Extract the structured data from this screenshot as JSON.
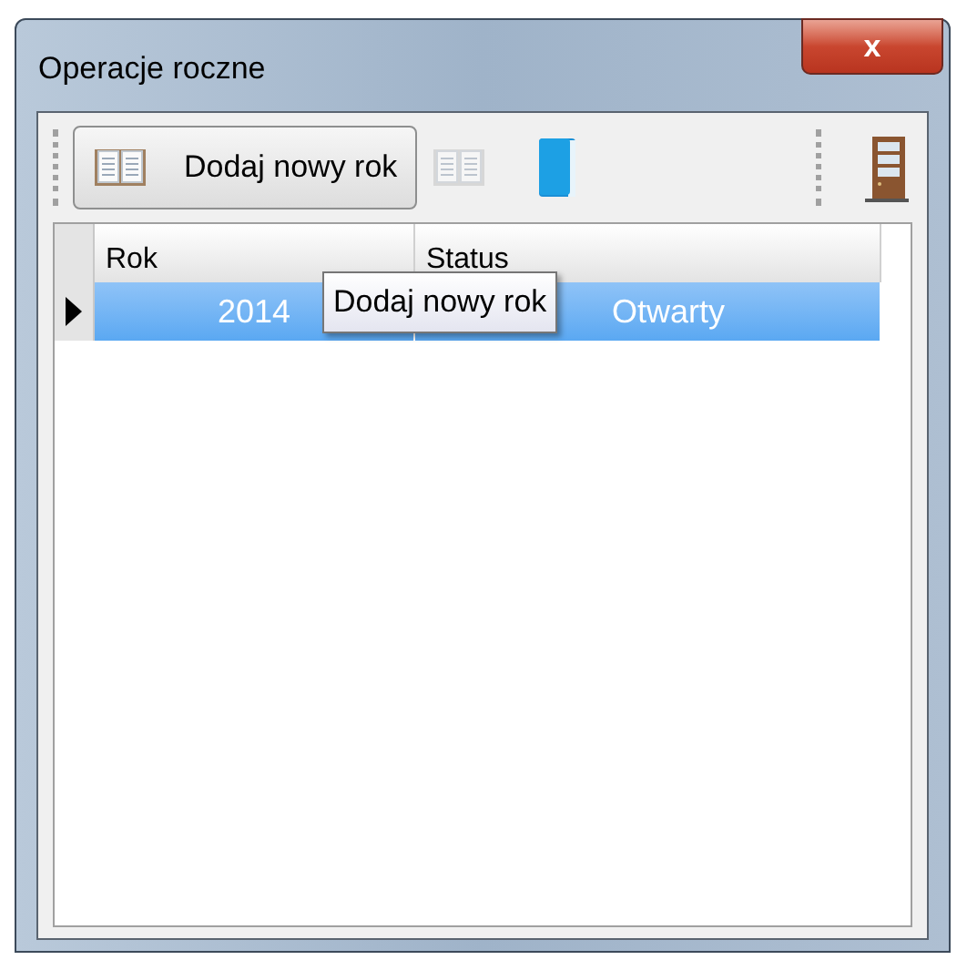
{
  "window": {
    "title": "Operacje roczne",
    "close_label": "x"
  },
  "toolbar": {
    "items": [
      {
        "kind": "button",
        "label": "Dodaj nowy rok",
        "disabled": false
      },
      {
        "kind": "open-book",
        "disabled": true
      },
      {
        "kind": "book",
        "disabled": false
      },
      {
        "kind": "separator"
      },
      {
        "kind": "door",
        "disabled": false
      }
    ]
  },
  "table": {
    "columns": [
      "Rok",
      "Status"
    ],
    "rows": [
      {
        "cells": [
          "2014",
          "Otwarty"
        ],
        "selected": true,
        "current": true
      }
    ]
  },
  "tooltip": {
    "text": "Dodaj nowy rok"
  }
}
